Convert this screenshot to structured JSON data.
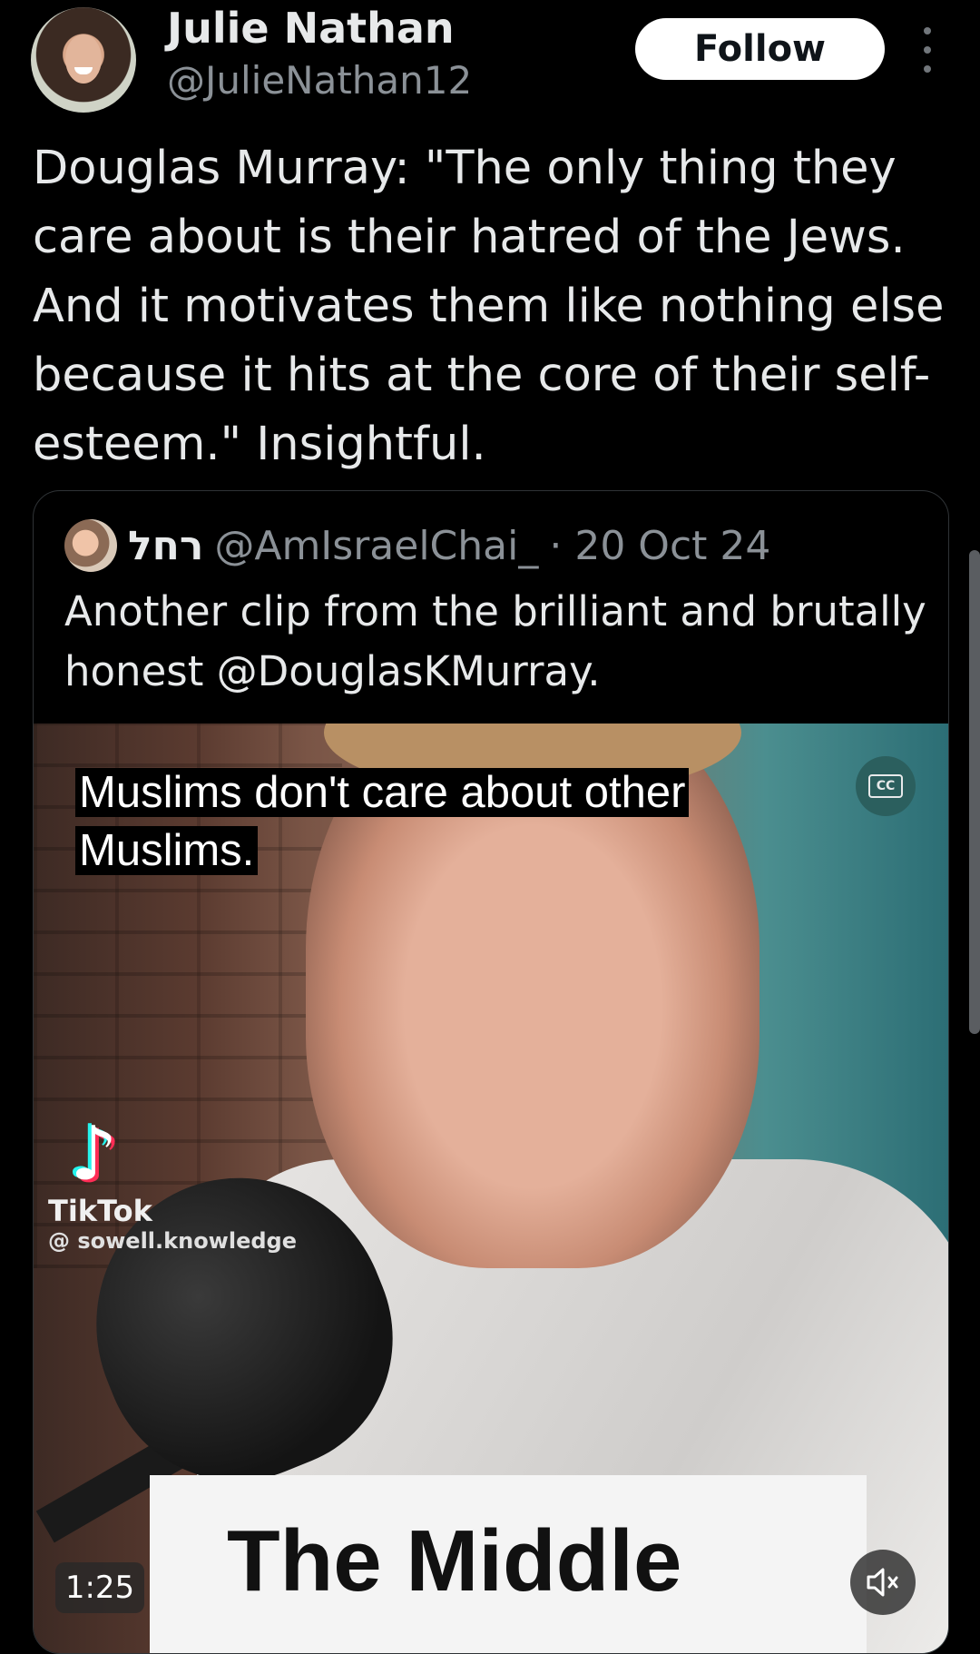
{
  "author": {
    "name": "Julie Nathan",
    "handle": "@JulieNathan12",
    "follow_label": "Follow"
  },
  "tweet_text": "Douglas Murray: \"The only thing they care about is their hatred of the Jews. And it motivates them like nothing else because it hits at the core of their self-esteem.\" Insightful.",
  "quote": {
    "name": "רחל",
    "handle": "@AmIsraelChai_",
    "date": "· 20 Oct 24",
    "text": "Another clip from the brilliant and brutally honest  @DouglasKMurray."
  },
  "video": {
    "caption_line1": " Muslims don't care about other",
    "caption_line2": "Muslims.",
    "cc_label": "CC",
    "tiktok_brand": "TikTok",
    "tiktok_user": "@ sowell.knowledge",
    "title_card": "The Middle",
    "duration": "1:25",
    "mute_icon": "muted-speaker-icon"
  }
}
